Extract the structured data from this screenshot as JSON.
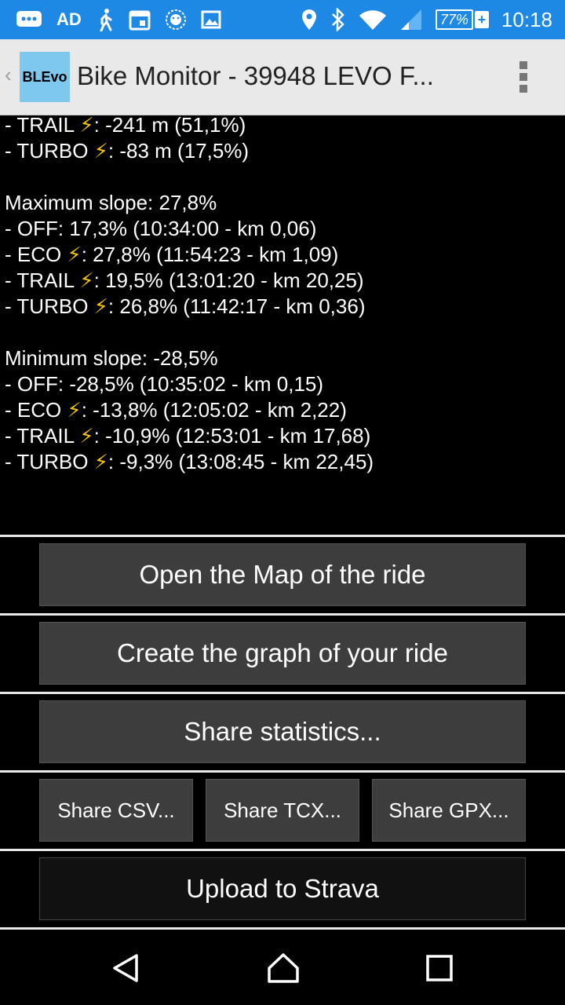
{
  "status_bar": {
    "left_icons": [
      "messages-icon",
      "ad-icon",
      "walking-icon",
      "calendar-icon",
      "lion-icon",
      "image-icon"
    ],
    "ad_text": "AD",
    "battery": "77%",
    "time": "10:18"
  },
  "action_bar": {
    "logo_text": "BLEvo",
    "title": "Bike Monitor - 39948 LEVO F..."
  },
  "stats_lines": [
    [
      {
        "t": "- TRAIL "
      },
      {
        "bolt": "⚡"
      },
      {
        "t": ": -241 m (51,1%)"
      }
    ],
    [
      {
        "t": "- TURBO "
      },
      {
        "bolt": "⚡"
      },
      {
        "t": ": -83 m (17,5%)"
      }
    ],
    [
      {
        "t": ""
      }
    ],
    [
      {
        "t": "Maximum slope: 27,8%"
      }
    ],
    [
      {
        "t": "- OFF: 17,3% (10:34:00 - km 0,06)"
      }
    ],
    [
      {
        "t": "- ECO "
      },
      {
        "bolt": "⚡"
      },
      {
        "t": ": 27,8% (11:54:23 - km 1,09)"
      }
    ],
    [
      {
        "t": "- TRAIL "
      },
      {
        "bolt": "⚡"
      },
      {
        "t": ": 19,5% (13:01:20 - km 20,25)"
      }
    ],
    [
      {
        "t": "- TURBO "
      },
      {
        "bolt": "⚡"
      },
      {
        "t": ": 26,8% (11:42:17 - km 0,36)"
      }
    ],
    [
      {
        "t": ""
      }
    ],
    [
      {
        "t": "Minimum slope: -28,5%"
      }
    ],
    [
      {
        "t": "- OFF: -28,5% (10:35:02 - km 0,15)"
      }
    ],
    [
      {
        "t": "- ECO "
      },
      {
        "bolt": "⚡"
      },
      {
        "t": ": -13,8% (12:05:02 - km 2,22)"
      }
    ],
    [
      {
        "t": "- TRAIL "
      },
      {
        "bolt": "⚡"
      },
      {
        "t": ": -10,9% (12:53:01 - km 17,68)"
      }
    ],
    [
      {
        "t": "- TURBO "
      },
      {
        "bolt": "⚡"
      },
      {
        "t": ": -9,3% (13:08:45 - km 22,45)"
      }
    ]
  ],
  "buttons": {
    "open_map": "Open the Map of the ride",
    "create_graph": "Create the graph of your ride",
    "share_statistics": "Share statistics...",
    "share_csv": "Share CSV...",
    "share_tcx": "Share TCX...",
    "share_gpx": "Share GPX...",
    "upload_strava": "Upload to Strava"
  },
  "colors": {
    "status_bar": "#1e88e5",
    "action_bar": "#e9e9e9",
    "button": "#3d3d3d",
    "bolt": "#f4c20d"
  }
}
